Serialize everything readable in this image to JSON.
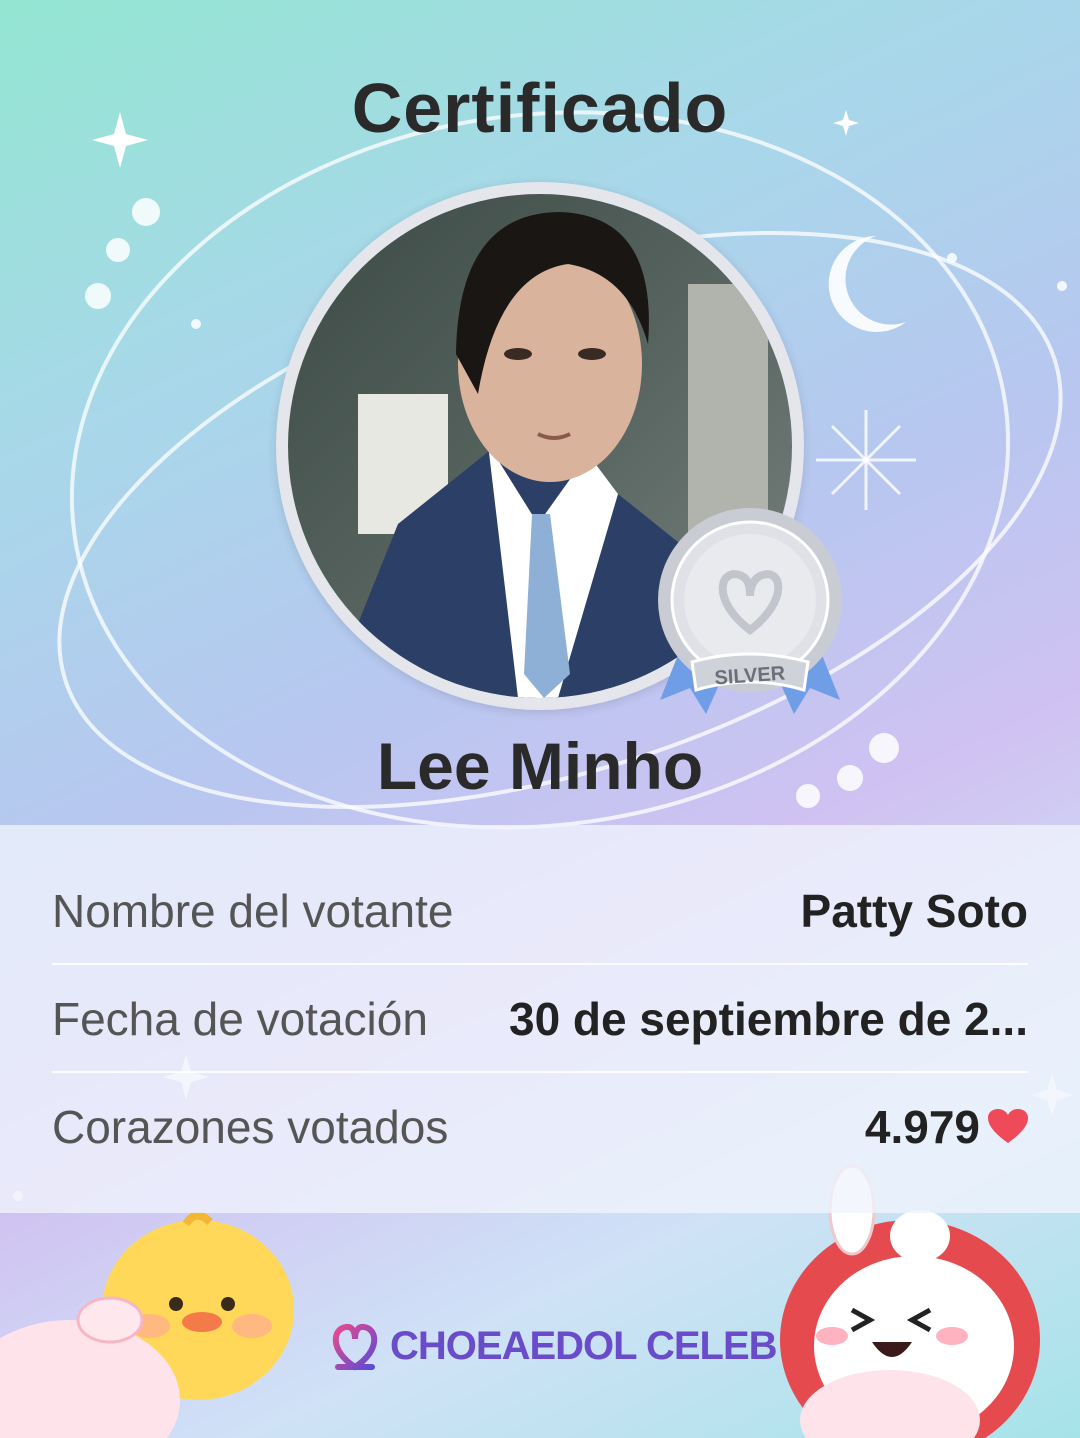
{
  "certificate": {
    "title": "Certificado",
    "celebrity_name": "Lee Minho",
    "badge_label": "SILVER"
  },
  "details": [
    {
      "label": "Nombre del votante",
      "value": "Patty Soto"
    },
    {
      "label": "Fecha de votación",
      "value": "30 de septiembre de 2..."
    },
    {
      "label": "Corazones votados",
      "value": "4.979"
    }
  ],
  "brand": {
    "name": "CHOEAEDOL CELEB"
  },
  "icons": {
    "heart": "heart-icon",
    "logo": "choeaedol-logo-icon",
    "medal": "silver-medal-icon"
  },
  "colors": {
    "heart": "#ef4a5a",
    "brand": "#6a4bc9",
    "silver": "#c9ccd3",
    "ribbon": "#6f9de6"
  }
}
